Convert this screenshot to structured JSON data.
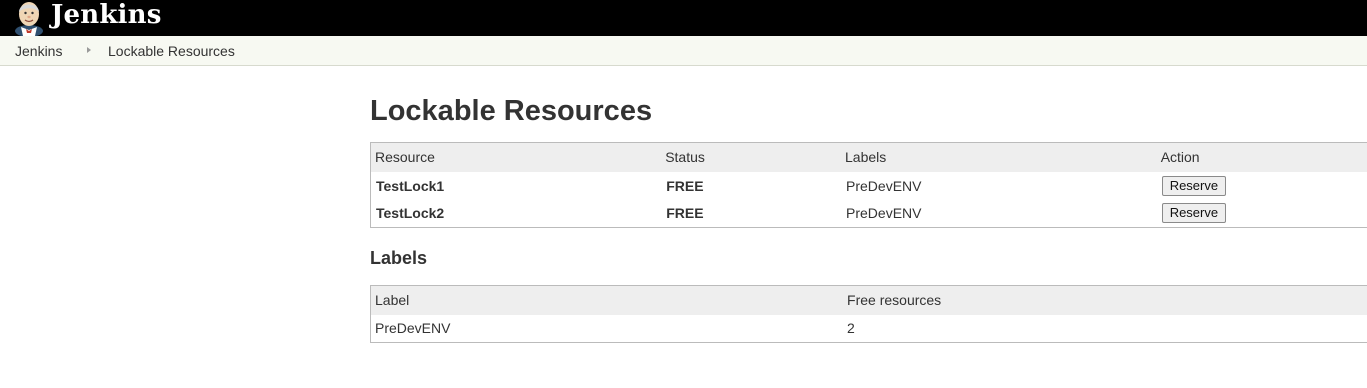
{
  "header": {
    "brand": "Jenkins",
    "logo_icon": "jenkins-butler-logo"
  },
  "breadcrumb": {
    "items": [
      "Jenkins",
      "Lockable Resources"
    ]
  },
  "page": {
    "title": "Lockable Resources"
  },
  "resources": {
    "headers": [
      "Resource",
      "Status",
      "Labels",
      "Action"
    ],
    "rows": [
      {
        "name": "TestLock1",
        "status": "FREE",
        "labels": "PreDevENV",
        "action": "Reserve"
      },
      {
        "name": "TestLock2",
        "status": "FREE",
        "labels": "PreDevENV",
        "action": "Reserve"
      }
    ]
  },
  "labels_section": {
    "title": "Labels",
    "headers": [
      "Label",
      "Free resources"
    ],
    "rows": [
      {
        "label": "PreDevENV",
        "free": "2"
      }
    ]
  },
  "colors": {
    "header_bg": "#000000",
    "free_status": "#138a1b",
    "link_green": "#1f8a23",
    "breadcrumb_bg": "#f7f9f2"
  }
}
